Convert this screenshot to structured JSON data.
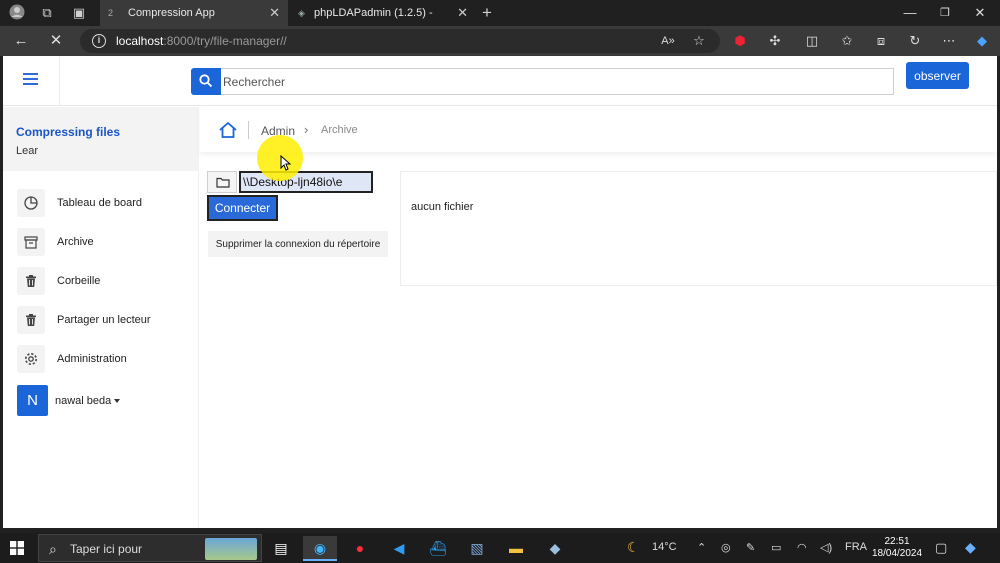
{
  "browser": {
    "tabs": [
      {
        "favicon": "2",
        "title": "Compression App",
        "active": true
      },
      {
        "favicon": "php",
        "title": "phpLDAPadmin (1.2.5) -",
        "active": false
      }
    ],
    "url_host": "localhost",
    "url_rest": ":8000/try/file-manager//"
  },
  "topnav": {
    "search_placeholder": "Rechercher",
    "observe_label": "observer"
  },
  "sidebar": {
    "title": "Compressing files",
    "subtitle": "Lear",
    "items": [
      {
        "label": "Tableau de board",
        "icon": "pie-chart-icon"
      },
      {
        "label": "Archive",
        "icon": "archive-box-icon"
      },
      {
        "label": "Corbeille",
        "icon": "trash-icon"
      },
      {
        "label": "Partager un lecteur",
        "icon": "trash-icon"
      },
      {
        "label": "Administration",
        "icon": "gear-icon"
      }
    ],
    "user": {
      "initial": "N",
      "name": "nawal beda"
    }
  },
  "breadcrumb": {
    "admin": "Admin",
    "archive": "Archive"
  },
  "connection": {
    "path_value": "\\\\Desktop-ljn48io\\e",
    "connect_label": "Connecter",
    "remove_label": "Supprimer la connexion du répertoire"
  },
  "files": {
    "empty_text": "aucun fichier"
  },
  "taskbar": {
    "search_placeholder": "Taper ici pour",
    "weather": "14°C",
    "language": "FRA",
    "time": "22:51",
    "date": "18/04/2024"
  },
  "colors": {
    "accent": "#1a66d8",
    "sidebar_title": "#1a55c8"
  }
}
